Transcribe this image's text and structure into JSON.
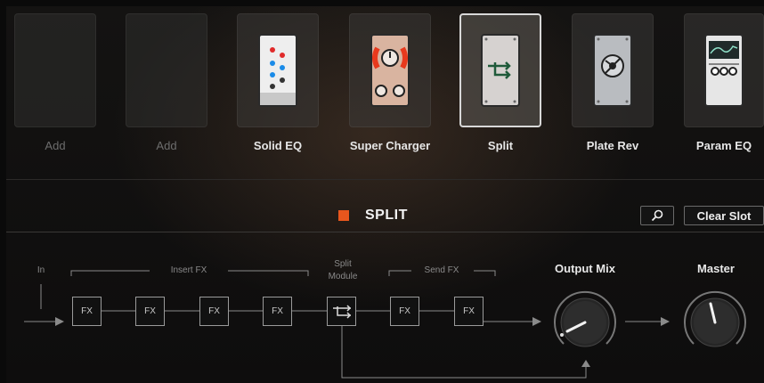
{
  "slots": [
    {
      "label": "Add",
      "state": "empty"
    },
    {
      "label": "Add",
      "state": "empty"
    },
    {
      "label": "Solid EQ",
      "icon": "solid-eq-pedal-icon"
    },
    {
      "label": "Super Charger",
      "icon": "super-charger-pedal-icon"
    },
    {
      "label": "Split",
      "icon": "split-pedal-icon",
      "selected": true
    },
    {
      "label": "Plate Rev",
      "icon": "plate-reverb-pedal-icon"
    },
    {
      "label": "Param EQ",
      "icon": "param-eq-pedal-icon"
    }
  ],
  "module_header": {
    "title": "SPLIT",
    "accent_color": "#e8561d",
    "search_icon": "search-icon",
    "clear_button": "Clear Slot"
  },
  "routing": {
    "in_label": "In",
    "insert_label": "Insert FX",
    "split_label_line1": "Split",
    "split_label_line2": "Module",
    "send_label": "Send FX",
    "fx_label": "FX",
    "output_mix_label": "Output Mix",
    "master_label": "Master"
  },
  "knobs": {
    "output_mix_level": 0.2,
    "master_level": 0.45
  }
}
